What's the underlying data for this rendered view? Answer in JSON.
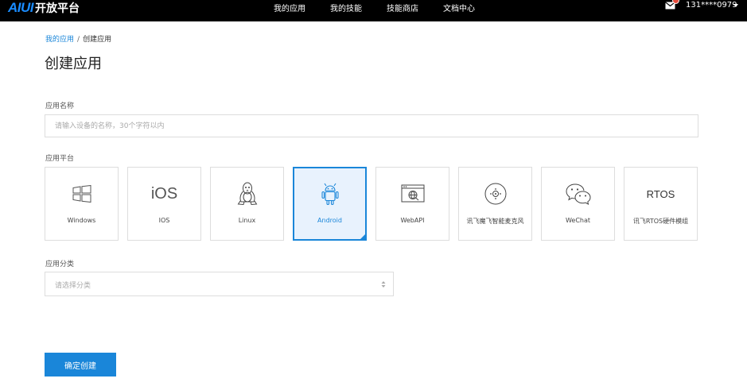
{
  "header": {
    "logo_mark": "AIUI",
    "logo_text": "开放平台",
    "nav": [
      "我的应用",
      "我的技能",
      "技能商店",
      "文档中心"
    ],
    "user": "131****0979"
  },
  "breadcrumb": {
    "parent": "我的应用",
    "separator": "/",
    "current": "创建应用"
  },
  "page_title": "创建应用",
  "form": {
    "name_label": "应用名称",
    "name_placeholder": "请输入设备的名称，30个字符以内",
    "platform_label": "应用平台",
    "platforms": [
      {
        "name": "Windows",
        "icon": "windows-icon"
      },
      {
        "name": "IOS",
        "icon": "ios-icon",
        "glyph": "iOS"
      },
      {
        "name": "Linux",
        "icon": "linux-icon"
      },
      {
        "name": "Android",
        "icon": "android-icon",
        "selected": true
      },
      {
        "name": "WebAPI",
        "icon": "webapi-icon"
      },
      {
        "name": "讯飞魔飞智能麦克风",
        "icon": "microphone-icon"
      },
      {
        "name": "WeChat",
        "icon": "wechat-icon"
      },
      {
        "name": "讯飞RTOS硬件模组",
        "icon": "rtos-icon",
        "glyph": "RTOS"
      }
    ],
    "category_label": "应用分类",
    "category_placeholder": "请选择分类",
    "submit_label": "确定创建"
  },
  "colors": {
    "accent": "#1a86d9",
    "topbar": "#000000",
    "selected_bg": "#e8f2fd"
  }
}
